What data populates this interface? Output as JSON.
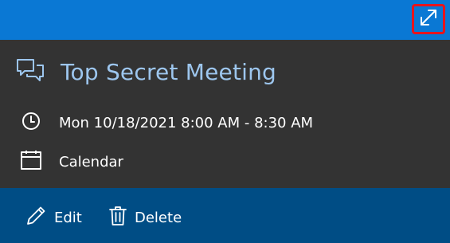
{
  "event": {
    "title": "Top Secret Meeting",
    "datetime": "Mon 10/18/2021 8:00 AM - 8:30 AM",
    "calendar": "Calendar"
  },
  "actions": {
    "edit_label": "Edit",
    "delete_label": "Delete"
  },
  "icons": {
    "expand": "expand-icon",
    "event": "chat-bubbles-icon",
    "time": "clock-icon",
    "calendar": "calendar-icon",
    "edit": "pencil-icon",
    "delete": "trash-icon"
  },
  "colors": {
    "header_blue": "#0a78d4",
    "footer_blue": "#004d85",
    "panel_dark": "#333333",
    "title_blue": "#9dc6ee",
    "highlight_red": "#e8141c"
  }
}
